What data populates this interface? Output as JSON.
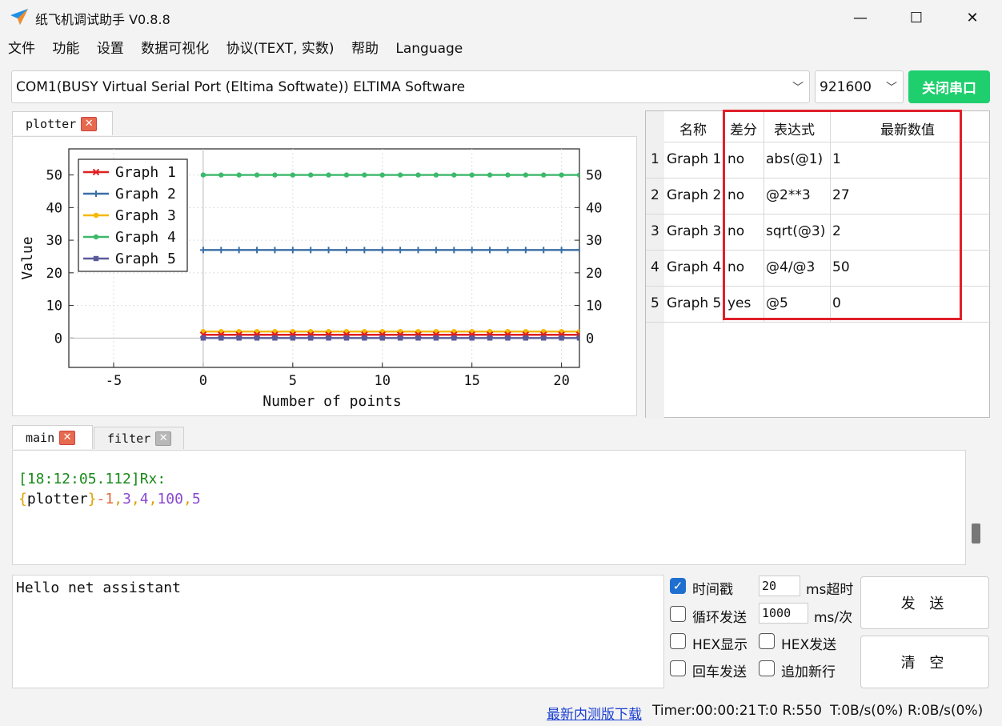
{
  "window": {
    "title": "纸飞机调试助手 V0.8.8",
    "minimize": "—",
    "maximize": "☐",
    "close": "✕"
  },
  "menu": [
    "文件",
    "功能",
    "设置",
    "数据可视化",
    "协议(TEXT, 实数)",
    "帮助",
    "Language"
  ],
  "port": {
    "selected": "COM1(BUSY  Virtual Serial Port (Eltima Softwate)) ELTIMA Software",
    "baud": "921600",
    "close_button": "关闭串口"
  },
  "plot_tab": {
    "label": "plotter",
    "close": "✕"
  },
  "chart_data": {
    "type": "line",
    "ylabel": "Value",
    "xlabel": "Number of points",
    "xlim": [
      -7.5,
      21
    ],
    "ylim": [
      -9,
      58
    ],
    "x_ticks": [
      -5,
      0,
      5,
      10,
      15,
      20
    ],
    "y_ticks": [
      0,
      10,
      20,
      30,
      40,
      50
    ],
    "grid": true,
    "legend_position": "top-left",
    "x": [
      0,
      1,
      2,
      3,
      4,
      5,
      6,
      7,
      8,
      9,
      10,
      11,
      12,
      13,
      14,
      15,
      16,
      17,
      18,
      19,
      20,
      21
    ],
    "series": [
      {
        "name": "Graph 1",
        "color": "#e02020",
        "marker": "x",
        "values": [
          1,
          1,
          1,
          1,
          1,
          1,
          1,
          1,
          1,
          1,
          1,
          1,
          1,
          1,
          1,
          1,
          1,
          1,
          1,
          1,
          1,
          1
        ]
      },
      {
        "name": "Graph 2",
        "color": "#3a6ea5",
        "marker": "plus",
        "values": [
          27,
          27,
          27,
          27,
          27,
          27,
          27,
          27,
          27,
          27,
          27,
          27,
          27,
          27,
          27,
          27,
          27,
          27,
          27,
          27,
          27,
          27
        ]
      },
      {
        "name": "Graph 3",
        "color": "#f5b800",
        "marker": "circle",
        "values": [
          2,
          2,
          2,
          2,
          2,
          2,
          2,
          2,
          2,
          2,
          2,
          2,
          2,
          2,
          2,
          2,
          2,
          2,
          2,
          2,
          2,
          2
        ]
      },
      {
        "name": "Graph 4",
        "color": "#3cb96b",
        "marker": "circle",
        "values": [
          50,
          50,
          50,
          50,
          50,
          50,
          50,
          50,
          50,
          50,
          50,
          50,
          50,
          50,
          50,
          50,
          50,
          50,
          50,
          50,
          50,
          50
        ]
      },
      {
        "name": "Graph 5",
        "color": "#5a5a9a",
        "marker": "square",
        "values": [
          0,
          0,
          0,
          0,
          0,
          0,
          0,
          0,
          0,
          0,
          0,
          0,
          0,
          0,
          0,
          0,
          0,
          0,
          0,
          0,
          0,
          0
        ]
      }
    ]
  },
  "table": {
    "headers": [
      "名称",
      "差分",
      "表达式",
      "最新数值"
    ],
    "rows": [
      {
        "index": "1",
        "name": "Graph 1",
        "diff": "no",
        "expr": "abs(@1)",
        "value": "1"
      },
      {
        "index": "2",
        "name": "Graph 2",
        "diff": "no",
        "expr": "@2**3",
        "value": "27"
      },
      {
        "index": "3",
        "name": "Graph 3",
        "diff": "no",
        "expr": "sqrt(@3)",
        "value": "2"
      },
      {
        "index": "4",
        "name": "Graph 4",
        "diff": "no",
        "expr": "@4/@3",
        "value": "50"
      },
      {
        "index": "5",
        "name": "Graph 5",
        "diff": "yes",
        "expr": "@5",
        "value": "0"
      }
    ],
    "highlight_color": "#e0202a"
  },
  "log_tabs": [
    {
      "label": "main",
      "close": "✕"
    },
    {
      "label": "filter",
      "close": "✕"
    }
  ],
  "log": {
    "timestamp": "[18:12:05.112]Rx:",
    "brace_open": "{",
    "tag": "plotter",
    "brace_close": "}",
    "values": [
      "-1",
      ",",
      "3",
      ",",
      "4",
      ",",
      "100",
      ",",
      "5"
    ]
  },
  "send": {
    "text": "Hello net assistant"
  },
  "options": {
    "timestamp_label": "时间戳",
    "timestamp_checked": true,
    "timeout_value": "20",
    "timeout_unit": "ms超时",
    "loop_label": "循环发送",
    "loop_value": "1000",
    "loop_unit": "ms/次",
    "hex_show": "HEX显示",
    "hex_send": "HEX发送",
    "enter_send": "回车发送",
    "append_newline": "追加新行",
    "send_button": "发 送",
    "clear_button": "清 空"
  },
  "status": {
    "link": "最新内测版下载",
    "timer": "Timer:00:00:21",
    "counts": "T:0 R:550",
    "rates": "T:0B/s(0%) R:0B/s(0%)"
  }
}
